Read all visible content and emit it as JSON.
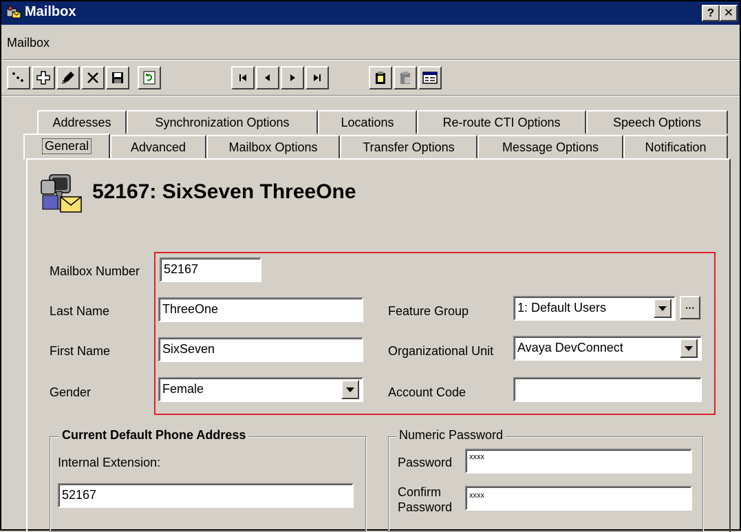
{
  "window": {
    "title": "Mailbox"
  },
  "menu": {
    "items": [
      "Mailbox"
    ]
  },
  "toolbar": {
    "buttons": [
      {
        "name": "query-icon"
      },
      {
        "name": "add-icon"
      },
      {
        "name": "edit-icon"
      },
      {
        "name": "delete-icon"
      },
      {
        "name": "save-icon"
      },
      {
        "name": "refresh-icon"
      },
      {
        "name": "first-record-icon"
      },
      {
        "name": "previous-record-icon"
      },
      {
        "name": "next-record-icon"
      },
      {
        "name": "last-record-icon"
      },
      {
        "name": "copy-icon"
      },
      {
        "name": "paste-icon"
      },
      {
        "name": "list-icon"
      }
    ]
  },
  "tabs": {
    "row1": [
      "Addresses",
      "Synchronization Options",
      "Locations",
      "Re-route CTI Options",
      "Speech Options"
    ],
    "row2": [
      "General",
      "Advanced",
      "Mailbox Options",
      "Transfer Options",
      "Message Options",
      "Notification"
    ],
    "active": "General"
  },
  "header": {
    "title": "52167: SixSeven ThreeOne"
  },
  "form": {
    "mailbox_number": {
      "label": "Mailbox Number",
      "value": "52167"
    },
    "last_name": {
      "label": "Last Name",
      "value": "ThreeOne"
    },
    "first_name": {
      "label": "First Name",
      "value": "SixSeven"
    },
    "gender": {
      "label": "Gender",
      "value": "Female"
    },
    "feature_group": {
      "label": "Feature Group",
      "value": "1: Default Users",
      "browse": "···"
    },
    "org_unit": {
      "label": "Organizational Unit",
      "value": "Avaya DevConnect"
    },
    "account_code": {
      "label": "Account Code",
      "value": ""
    }
  },
  "phone_group": {
    "title": "Current Default Phone Address",
    "ext_label": "Internal Extension:",
    "ext_value": "52167"
  },
  "password_group": {
    "title": "Numeric Password",
    "password_label": "Password",
    "password_value": "xxxx",
    "confirm_label_1": "Confirm",
    "confirm_label_2": "Password",
    "confirm_value": "xxxx"
  },
  "colors": {
    "titlebar": "#0a246a",
    "highlight": "#e0202a",
    "face": "#d4d0c8"
  }
}
